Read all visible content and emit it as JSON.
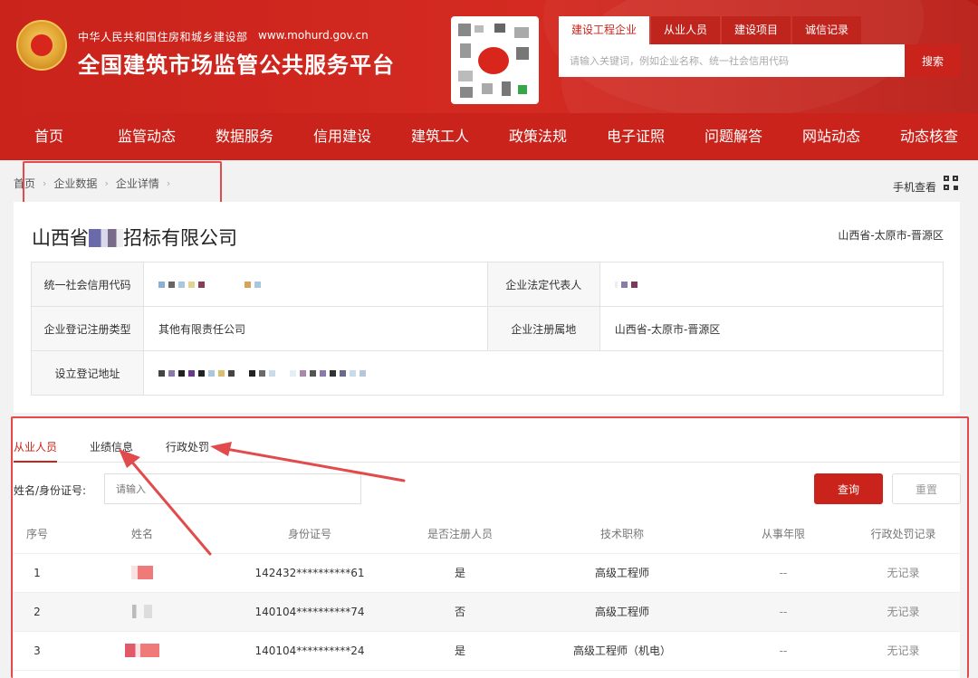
{
  "header": {
    "ministry": "中华人民共和国住房和城乡建设部",
    "site_url": "www.mohurd.gov.cn",
    "platform_title": "全国建筑市场监管公共服务平台"
  },
  "search": {
    "tabs": [
      "建设工程企业",
      "从业人员",
      "建设项目",
      "诚信记录"
    ],
    "placeholder": "请输入关键词，例如企业名称、统一社会信用代码",
    "button_label": "搜索"
  },
  "nav": {
    "items": [
      "首页",
      "监管动态",
      "数据服务",
      "信用建设",
      "建筑工人",
      "政策法规",
      "电子证照",
      "问题解答",
      "网站动态",
      "动态核查"
    ]
  },
  "breadcrumb": {
    "items": [
      "首页",
      "企业数据",
      "企业详情"
    ],
    "mobile_view_label": "手机查看"
  },
  "company": {
    "name_prefix": "山西省",
    "name_suffix": "招标有限公司",
    "region": "山西省-太原市-晋源区",
    "credit_code_label": "统一社会信用代码",
    "legal_rep_label": "企业法定代表人",
    "reg_type_label": "企业登记注册类型",
    "reg_type_value": "其他有限责任公司",
    "reg_place_label": "企业注册属地",
    "reg_place_value": "山西省-太原市-晋源区",
    "address_label": "设立登记地址"
  },
  "staff": {
    "tabs": [
      "从业人员",
      "业绩信息",
      "行政处罚"
    ],
    "filter_label": "姓名/身份证号:",
    "filter_placeholder": "请输入",
    "query_label": "查询",
    "reset_label": "重置",
    "columns": [
      "序号",
      "姓名",
      "身份证号",
      "是否注册人员",
      "技术职称",
      "从事年限",
      "行政处罚记录"
    ],
    "rows": [
      {
        "index": "1",
        "id": "142432**********61",
        "registered": "是",
        "title": "高级工程师",
        "years": "--",
        "penalty": "无记录"
      },
      {
        "index": "2",
        "id": "140104**********74",
        "registered": "否",
        "title": "高级工程师",
        "years": "--",
        "penalty": "无记录"
      },
      {
        "index": "3",
        "id": "140104**********24",
        "registered": "是",
        "title": "高级工程师（机电）",
        "years": "--",
        "penalty": "无记录"
      }
    ]
  },
  "colors": {
    "brand_red": "#c9231b",
    "annotation_red": "#e24b4b"
  }
}
